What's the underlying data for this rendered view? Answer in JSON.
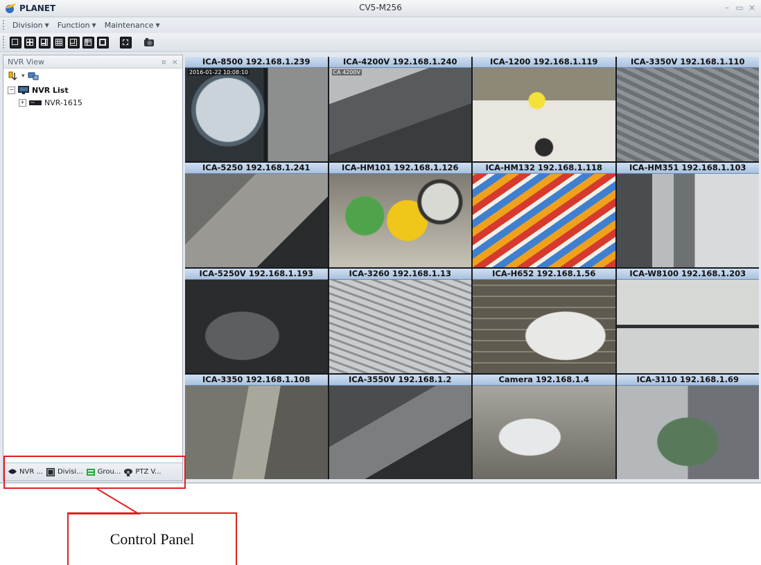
{
  "window": {
    "brand": "PLANET",
    "title": "CV5-M256"
  },
  "menu": [
    {
      "label": "Division"
    },
    {
      "label": "Function"
    },
    {
      "label": "Maintenance"
    }
  ],
  "toolbar": {
    "layouts": [
      "1x1",
      "2x2",
      "1+5",
      "3x3",
      "1+7",
      "4x4",
      "1+12"
    ],
    "extra": [
      "fullscreen",
      "snapshot"
    ]
  },
  "left_panel": {
    "title": "NVR View",
    "tree": {
      "root": "NVR List",
      "children": [
        "NVR-1615"
      ]
    },
    "tabs": [
      {
        "label": "NVR ...",
        "icon": "nvr-icon"
      },
      {
        "label": "Divisi...",
        "icon": "division-icon"
      },
      {
        "label": "Grou...",
        "icon": "group-icon"
      },
      {
        "label": "PTZ V...",
        "icon": "ptz-icon"
      }
    ]
  },
  "cameras": [
    {
      "label": "ICA-8500 192.168.1.239",
      "osd": "2016-01-22 10:08:10"
    },
    {
      "label": "ICA-4200V 192.168.1.240",
      "osd": "CA 4200V"
    },
    {
      "label": "ICA-1200 192.168.1.119",
      "osd": ""
    },
    {
      "label": "ICA-3350V 192.168.1.110",
      "osd": ""
    },
    {
      "label": "ICA-5250 192.168.1.241",
      "osd": ""
    },
    {
      "label": "ICA-HM101 192.168.1.126",
      "osd": ""
    },
    {
      "label": "ICA-HM132 192.168.1.118",
      "osd": ""
    },
    {
      "label": "ICA-HM351 192.168.1.103",
      "osd": ""
    },
    {
      "label": "ICA-5250V 192.168.1.193",
      "osd": ""
    },
    {
      "label": "ICA-3260 192.168.1.13",
      "osd": ""
    },
    {
      "label": "ICA-H652 192.168.1.56",
      "osd": ""
    },
    {
      "label": "ICA-W8100 192.168.1.203",
      "osd": ""
    },
    {
      "label": "ICA-3350 192.168.1.108",
      "osd": ""
    },
    {
      "label": "ICA-3550V 192.168.1.2",
      "osd": ""
    },
    {
      "label": "Camera 192.168.1.4",
      "osd": ""
    },
    {
      "label": "ICA-3110 192.168.1.69",
      "osd": ""
    }
  ],
  "annotation": {
    "label": "Control Panel",
    "color": "#e01f1f"
  }
}
